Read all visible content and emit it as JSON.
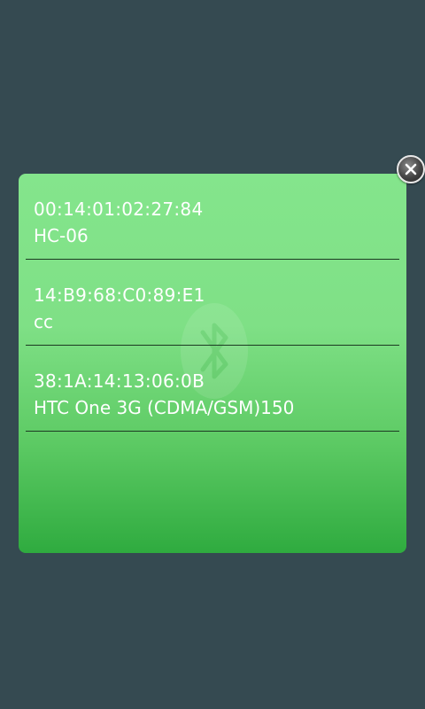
{
  "dialog": {
    "devices": [
      {
        "address": "00:14:01:02:27:84",
        "name": "HC-06"
      },
      {
        "address": "14:B9:68:C0:89:E1",
        "name": "cc"
      },
      {
        "address": "38:1A:14:13:06:0B",
        "name": "HTC One 3G (CDMA/GSM)150"
      }
    ],
    "watermark_icon": "bluetooth-icon",
    "close_icon": "close-icon"
  },
  "colors": {
    "background": "#354a51",
    "dialog_top": "#84e58c",
    "dialog_bottom": "#2fab3f",
    "text": "#ffffff",
    "divider": "#1c3a22"
  }
}
